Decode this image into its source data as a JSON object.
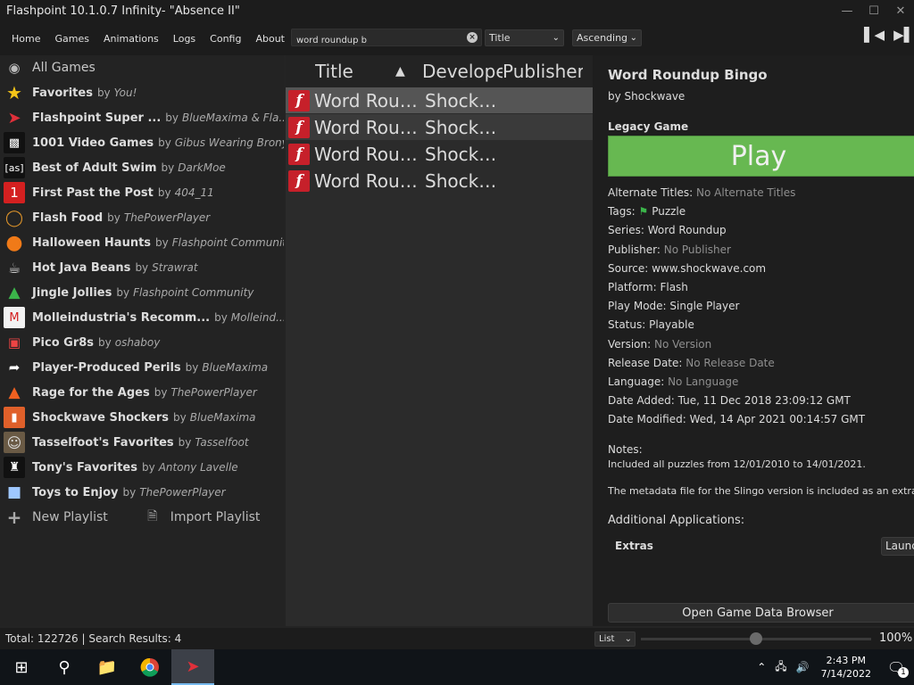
{
  "window": {
    "title": "Flashpoint 10.1.0.7 Infinity- \"Absence II\""
  },
  "menu": [
    "Home",
    "Games",
    "Animations",
    "Logs",
    "Config",
    "About"
  ],
  "search": {
    "value": "word roundup b"
  },
  "order_by": {
    "selected": "Title"
  },
  "order_dir": {
    "selected": "Ascending"
  },
  "sidebar": {
    "all_games": "All Games",
    "playlists": [
      {
        "name": "Favorites",
        "by": "by",
        "author": "You!",
        "icon": "star-icon"
      },
      {
        "name": "Flashpoint Super ...",
        "by": "by",
        "author": "BlueMaxima & Fla...",
        "icon": "flashpoint-logo-icon"
      },
      {
        "name": "1001 Video Games",
        "by": "by",
        "author": "Gibus Wearing Brony",
        "icon": "space-invader-icon"
      },
      {
        "name": "Best of Adult Swim",
        "by": "by",
        "author": "DarkMoe",
        "icon": "adult-swim-icon"
      },
      {
        "name": "First Past the Post",
        "by": "by",
        "author": "404_11",
        "icon": "number-one-icon"
      },
      {
        "name": "Flash Food",
        "by": "by",
        "author": "ThePowerPlayer",
        "icon": "burger-icon"
      },
      {
        "name": "Halloween Haunts",
        "by": "by",
        "author": "Flashpoint Community",
        "icon": "pumpkin-icon"
      },
      {
        "name": "Hot Java Beans",
        "by": "by",
        "author": "Strawrat",
        "icon": "coffee-icon"
      },
      {
        "name": "Jingle Jollies",
        "by": "by",
        "author": "Flashpoint Community",
        "icon": "christmas-tree-icon"
      },
      {
        "name": "Molleindustria's Recomm...",
        "by": "by",
        "author": "Molleind...",
        "icon": "molleindustria-icon"
      },
      {
        "name": "Pico Gr8s",
        "by": "by",
        "author": "oshaboy",
        "icon": "pixel-grid-icon"
      },
      {
        "name": "Player-Produced Perils",
        "by": "by",
        "author": "BlueMaxima",
        "icon": "share-arrow-icon"
      },
      {
        "name": "Rage for the Ages",
        "by": "by",
        "author": "ThePowerPlayer",
        "icon": "fire-icon"
      },
      {
        "name": "Shockwave Shockers",
        "by": "by",
        "author": "BlueMaxima",
        "icon": "shockwave-icon"
      },
      {
        "name": "Tasselfoot's Favorites",
        "by": "by",
        "author": "Tasselfoot",
        "icon": "tasselfoot-icon"
      },
      {
        "name": "Tony's Favorites",
        "by": "by",
        "author": "Antony Lavelle",
        "icon": "figure-icon"
      },
      {
        "name": "Toys to Enjoy",
        "by": "by",
        "author": "ThePowerPlayer",
        "icon": "toy-blocks-icon"
      }
    ],
    "new_playlist": "New Playlist",
    "import_playlist": "Import Playlist"
  },
  "list": {
    "columns": [
      "Title",
      "Develope",
      "Publisher"
    ],
    "rows": [
      {
        "title": "Word Roun...",
        "developer": "Shockw..."
      },
      {
        "title": "Word Roun...",
        "developer": "Shockw..."
      },
      {
        "title": "Word Roun...",
        "developer": "Shockw..."
      },
      {
        "title": "Word Roun...",
        "developer": "Shockw..."
      }
    ]
  },
  "details": {
    "title": "Word Roundup Bingo",
    "by_line": "by Shockwave",
    "legacy": "Legacy Game",
    "play": "Play",
    "fields": [
      {
        "key": "Alternate Titles:",
        "value": "No Alternate Titles",
        "dim": true
      },
      {
        "key": "Tags:",
        "value": "Puzzle",
        "dim": false,
        "tag": true
      },
      {
        "key": "Series:",
        "value": "Word Roundup",
        "dim": false
      },
      {
        "key": "Publisher:",
        "value": "No Publisher",
        "dim": true
      },
      {
        "key": "Source:",
        "value": "www.shockwave.com",
        "dim": false
      },
      {
        "key": "Platform:",
        "value": "Flash",
        "dim": false
      },
      {
        "key": "Play Mode:",
        "value": "Single Player",
        "dim": false
      },
      {
        "key": "Status:",
        "value": "Playable",
        "dim": false
      },
      {
        "key": "Version:",
        "value": "No Version",
        "dim": true
      },
      {
        "key": "Release Date:",
        "value": "No Release Date",
        "dim": true
      },
      {
        "key": "Language:",
        "value": "No Language",
        "dim": true
      },
      {
        "key": "Date Added:",
        "value": "Tue, 11 Dec 2018 23:09:12 GMT",
        "dim": false
      },
      {
        "key": "Date Modified:",
        "value": "Wed, 14 Apr 2021 00:14:57 GMT",
        "dim": false
      }
    ],
    "notes_label": "Notes:",
    "notes_line1": "Included all puzzles from 12/01/2010 to 14/01/2021.",
    "notes_line2": "The metadata file for the Slingo version is included as an extra.",
    "additional_apps": "Additional Applications:",
    "extras": "Extras",
    "launch": "Launch",
    "open_browser": "Open Game Data Browser"
  },
  "footer": {
    "status": "Total: 122726  |  Search Results: 4",
    "view": "List",
    "zoom": "100%",
    "zoom_level": 0.5
  },
  "taskbar": {
    "time": "2:43 PM",
    "date": "7/14/2022",
    "notifications": "1"
  },
  "colors": {
    "play": "#67b851",
    "flash": "#c6202a",
    "selected_row": "#555555"
  }
}
